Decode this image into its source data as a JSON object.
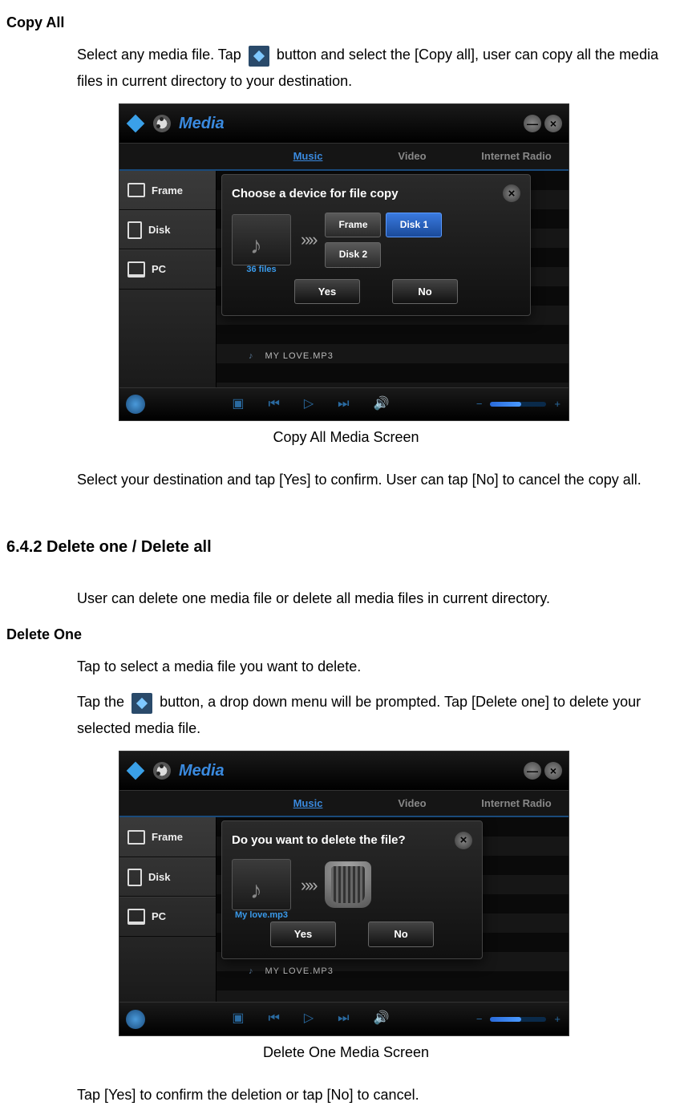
{
  "headings": {
    "copy_all": "Copy All",
    "section_642": "6.4.2 Delete one / Delete all",
    "delete_one": "Delete One"
  },
  "paragraphs": {
    "copy_all_intro_a": "Select any media file. Tap ",
    "copy_all_intro_b": " button and select the [Copy all], user can copy all the media files in current directory to your destination.",
    "copy_all_confirm": "Select your destination and tap [Yes] to confirm. User can tap [No] to cancel the copy all.",
    "section_intro": "User can delete one media file or delete all media files in current directory.",
    "delete_one_select": "Tap to select a media file you want to delete.",
    "delete_one_tap_a": "Tap the ",
    "delete_one_tap_b": " button, a drop down menu will be prompted. Tap [Delete one] to delete your selected media file.",
    "delete_one_confirm": "Tap [Yes] to confirm the deletion or tap [No] to cancel."
  },
  "captions": {
    "copy_all": "Copy All Media Screen",
    "delete_one": "Delete One Media Screen"
  },
  "ui": {
    "app_title": "Media",
    "tabs": {
      "music": "Music",
      "video": "Video",
      "radio": "Internet Radio"
    },
    "sidebar": {
      "frame": "Frame",
      "disk": "Disk",
      "pc": "PC"
    },
    "track": "MY LOVE.MP3",
    "minimize": "—",
    "close": "×"
  },
  "copy_dialog": {
    "title": "Choose a device for file copy",
    "thumb_label": "36 files",
    "devices": {
      "frame": "Frame",
      "disk1": "Disk 1",
      "disk2": "Disk 2"
    },
    "yes": "Yes",
    "no": "No"
  },
  "delete_dialog": {
    "title": "Do you want to delete the file?",
    "thumb_label": "My love.mp3",
    "yes": "Yes",
    "no": "No"
  }
}
